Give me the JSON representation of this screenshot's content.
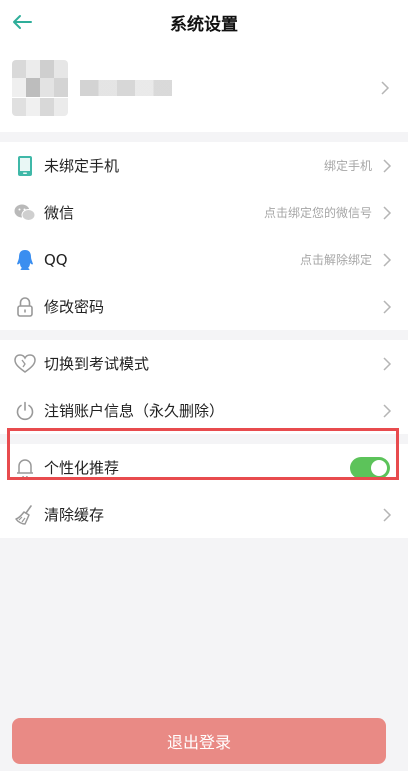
{
  "header": {
    "title": "系统设置"
  },
  "colors": {
    "accent": "#5cc35a",
    "logout": "#e98a85",
    "highlight": "#e84b4e"
  },
  "account": [
    {
      "label": "未绑定手机",
      "value": "绑定手机",
      "icon": "phone-icon"
    },
    {
      "label": "微信",
      "value": "点击绑定您的微信号",
      "icon": "wechat-icon"
    },
    {
      "label": "QQ",
      "value": "点击解除绑定",
      "icon": "qq-icon"
    },
    {
      "label": "修改密码",
      "value": "",
      "icon": "lock-icon"
    }
  ],
  "mode": [
    {
      "label": "切换到考试模式",
      "icon": "heart-icon"
    },
    {
      "label": "注销账户信息（永久删除）",
      "icon": "power-icon"
    }
  ],
  "misc": [
    {
      "label": "个性化推荐",
      "icon": "bell-icon",
      "toggle": true
    },
    {
      "label": "清除缓存",
      "icon": "broom-icon"
    }
  ],
  "logout_label": "退出登录"
}
